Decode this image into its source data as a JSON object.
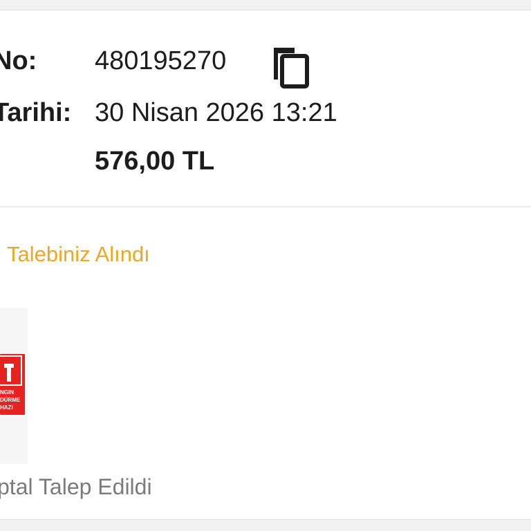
{
  "order": {
    "number_label": "No:",
    "number_value": "480195270",
    "date_label": "Tarihi:",
    "date_value": "30 Nisan 2026 13:21",
    "total_label": ":",
    "total_value": "576,00 TL"
  },
  "icons": {
    "copy": "copy-icon"
  },
  "item": {
    "status_text": "Talebiniz Alındı",
    "status_color": "#f0a623",
    "product_sign_text": "NGIN\nDÜRME\nHAZI",
    "product_sign_color": "#e52421",
    "cancel_text": "ptal Talep Edildi"
  }
}
